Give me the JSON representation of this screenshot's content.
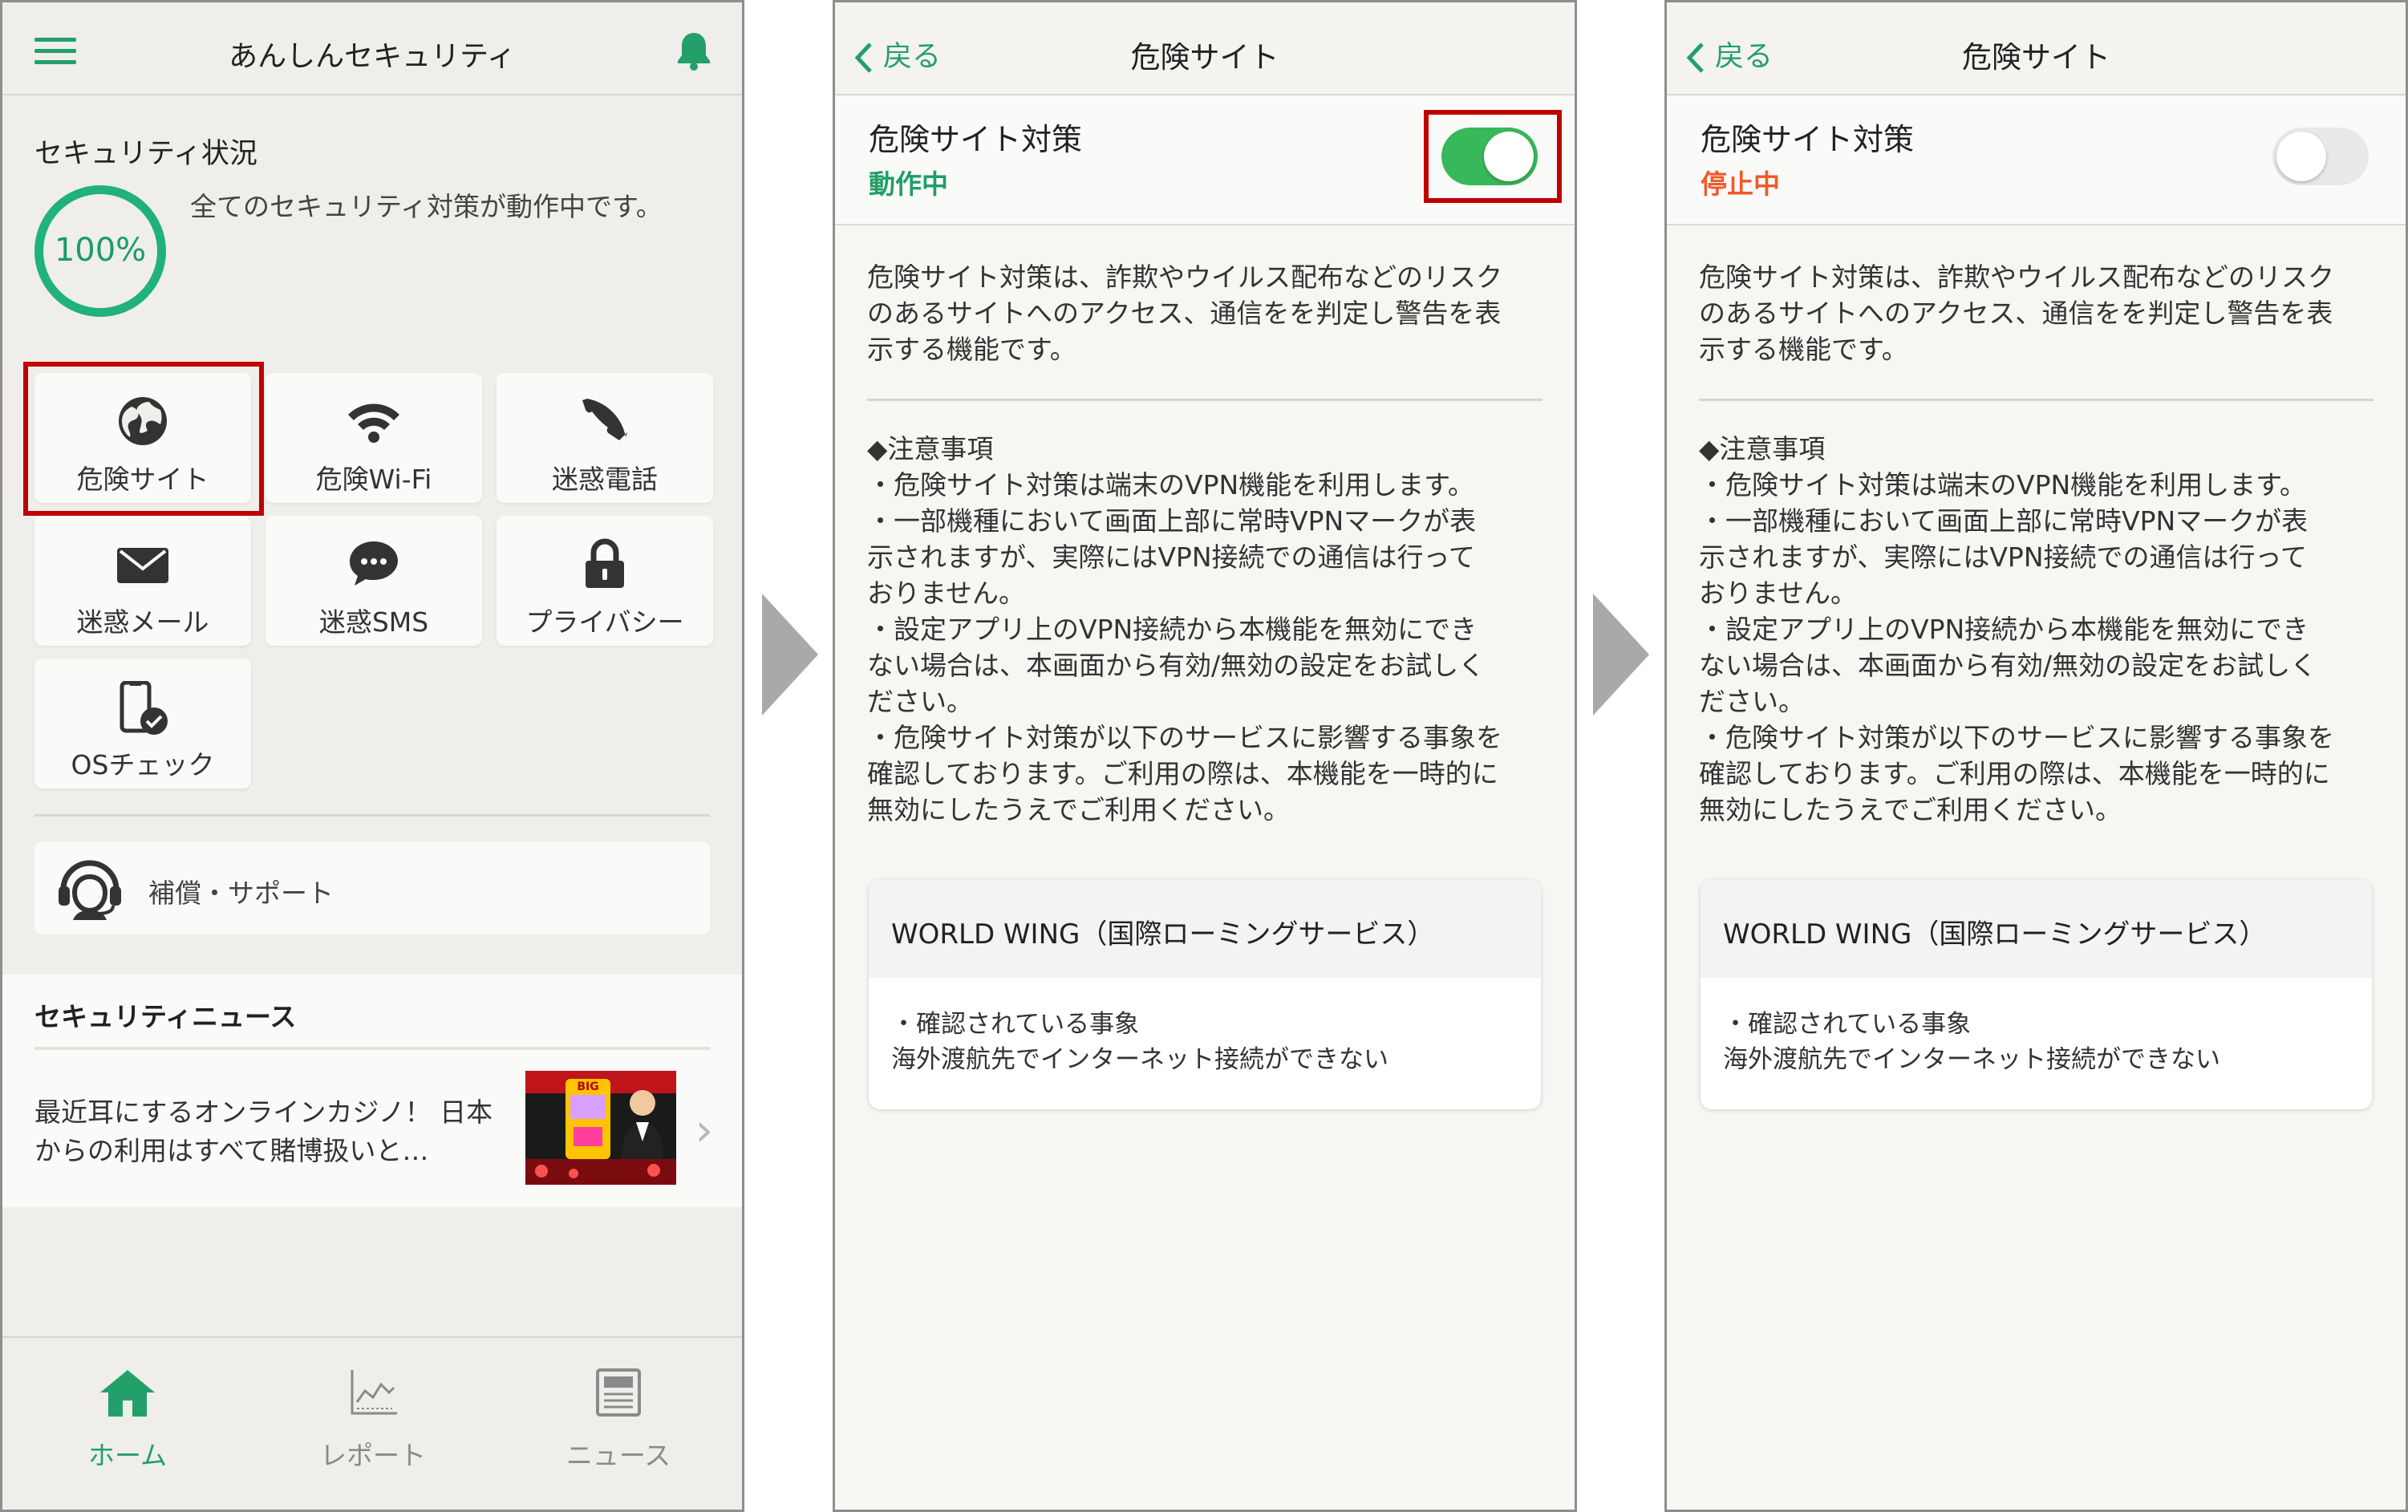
{
  "colors": {
    "accent": "#23a06a",
    "active_status": "#1f9e66",
    "stopped_status": "#ef5a2a",
    "highlight": "#c00000",
    "toggle_on": "#37b85a",
    "toggle_off": "#e9e9ea"
  },
  "home": {
    "title": "あんしんセキュリティ",
    "security_label": "セキュリティ状況",
    "progress_value": "100%",
    "progress_fraction": 1.0,
    "status_message": "全てのセキュリティ対策が動作中です。",
    "tiles": [
      {
        "label": "危険サイト",
        "icon": "globe-icon"
      },
      {
        "label": "危険Wi-Fi",
        "icon": "wifi-icon"
      },
      {
        "label": "迷惑電話",
        "icon": "phone-icon"
      },
      {
        "label": "迷惑メール",
        "icon": "mail-icon"
      },
      {
        "label": "迷惑SMS",
        "icon": "chat-bubble-icon"
      },
      {
        "label": "プライバシー",
        "icon": "lock-icon"
      },
      {
        "label": "OSチェック",
        "icon": "phone-check-icon"
      }
    ],
    "support_label": "補償・サポート",
    "news_header": "セキュリティニュース",
    "news_item_text": "最近耳にするオンラインカジノ！ 日本からの利用はすべて賭博扱いと…",
    "news_image_caption": "BIG",
    "tabs": [
      {
        "label": "ホーム",
        "icon": "home-icon",
        "active": true
      },
      {
        "label": "レポート",
        "icon": "chart-icon",
        "active": false
      },
      {
        "label": "ニュース",
        "icon": "newspaper-icon",
        "active": false
      }
    ]
  },
  "detail_on": {
    "back_label": "戻る",
    "nav_title": "危険サイト",
    "setting_title": "危険サイト対策",
    "status": "動作中",
    "toggle_on": true
  },
  "detail_off": {
    "back_label": "戻る",
    "nav_title": "危険サイト",
    "setting_title": "危険サイト対策",
    "status": "停止中",
    "toggle_on": false
  },
  "detail_common": {
    "description": [
      "危険サイト対策は、詐欺やウイルス配布などのリスク",
      "のあるサイトへのアクセス、通信をを判定し警告を表",
      "示する機能です。"
    ],
    "notes": [
      "◆注意事項",
      "・危険サイト対策は端末のVPN機能を利用します。",
      "・一部機種において画面上部に常時VPNマークが表",
      "示されますが、実際にはVPN接続での通信は行って",
      "おりません。",
      "・設定アプリ上のVPN接続から本機能を無効にでき",
      "ない場合は、本画面から有効/無効の設定をお試しく",
      "ださい。",
      "・危険サイト対策が以下のサービスに影響する事象を",
      "確認しております。ご利用の際は、本機能を一時的に",
      "無効にしたうえでご利用ください。"
    ],
    "service_card": {
      "title": "WORLD WING（国際ローミングサービス）",
      "lines": [
        "・確認されている事象",
        "海外渡航先でインターネット接続ができない"
      ]
    }
  }
}
